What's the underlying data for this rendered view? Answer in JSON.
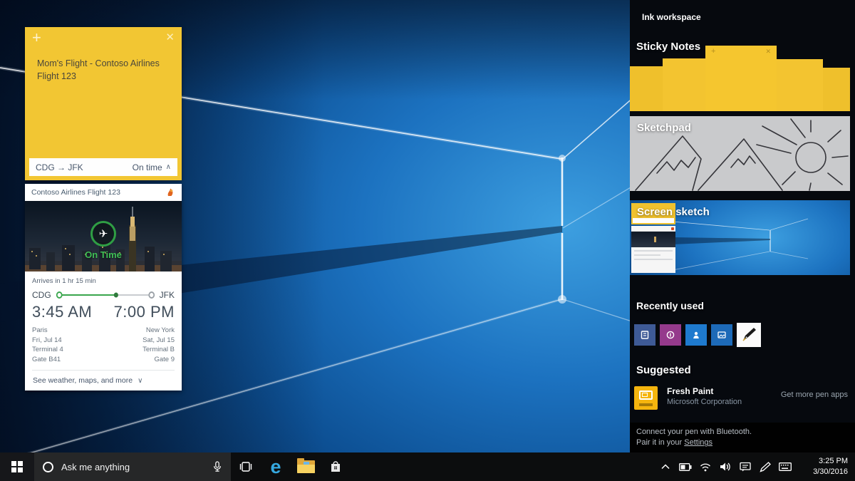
{
  "icons": {
    "plus": "+",
    "close": "✕",
    "chevron_up": "∧",
    "chevron_down": "∨",
    "plane": "✈"
  },
  "sticky_note": {
    "title": "Mom's Flight - Contoso Airlines Flight 123",
    "route": "CDG → JFK",
    "status": "On time"
  },
  "flight_card": {
    "header": "Contoso Airlines Flight 123",
    "status": "On Time",
    "arrival_note": "Arrives in 1 hr 15 min",
    "origin": {
      "code": "CDG",
      "time": "3:45 AM",
      "city": "Paris",
      "date": "Fri, Jul 14",
      "terminal": "Terminal 4",
      "gate": "Gate B41"
    },
    "destination": {
      "code": "JFK",
      "time": "7:00 PM",
      "city": "New York",
      "date": "Sat, Jul 15",
      "terminal": "Terminal B",
      "gate": "Gate 9"
    },
    "footer": "See weather, maps, and more"
  },
  "ink_workspace": {
    "title": "Ink workspace",
    "sticky_notes_label": "Sticky Notes",
    "sketchpad_label": "Sketchpad",
    "screen_sketch_label": "Screen sketch",
    "recently_used_label": "Recently used",
    "recently_used_apps": [
      {
        "icon": "document-app-icon",
        "color": "#3e5a96"
      },
      {
        "icon": "onenote-app-icon",
        "color": "#953a8c"
      },
      {
        "icon": "maps-app-icon",
        "color": "#1e7ace"
      },
      {
        "icon": "photos-app-icon",
        "color": "#1d6ab8"
      },
      {
        "icon": "fountain-pen-app-icon",
        "color": "#fbfbfb"
      }
    ],
    "suggested_label": "Suggested",
    "suggested_app": {
      "name": "Fresh Paint",
      "publisher": "Microsoft Corporation"
    },
    "get_more_link": "Get more pen apps",
    "pen_tip_line1": "Connect your pen with Bluetooth.",
    "pen_tip_line2_prefix": "Pair it in your ",
    "pen_tip_link": "Settings"
  },
  "taskbar": {
    "search_placeholder": "Ask me anything",
    "clock": {
      "time": "3:25 PM",
      "date": "3/30/2016"
    }
  },
  "colors": {
    "note_yellow": "#f2c633",
    "panel_bg": "#06090e",
    "status_green": "#3aa64d",
    "freshpaint_yellow": "#f5b50e",
    "edge_blue": "#35a8e0",
    "wallpaper_azure": "#3d9fe0"
  }
}
